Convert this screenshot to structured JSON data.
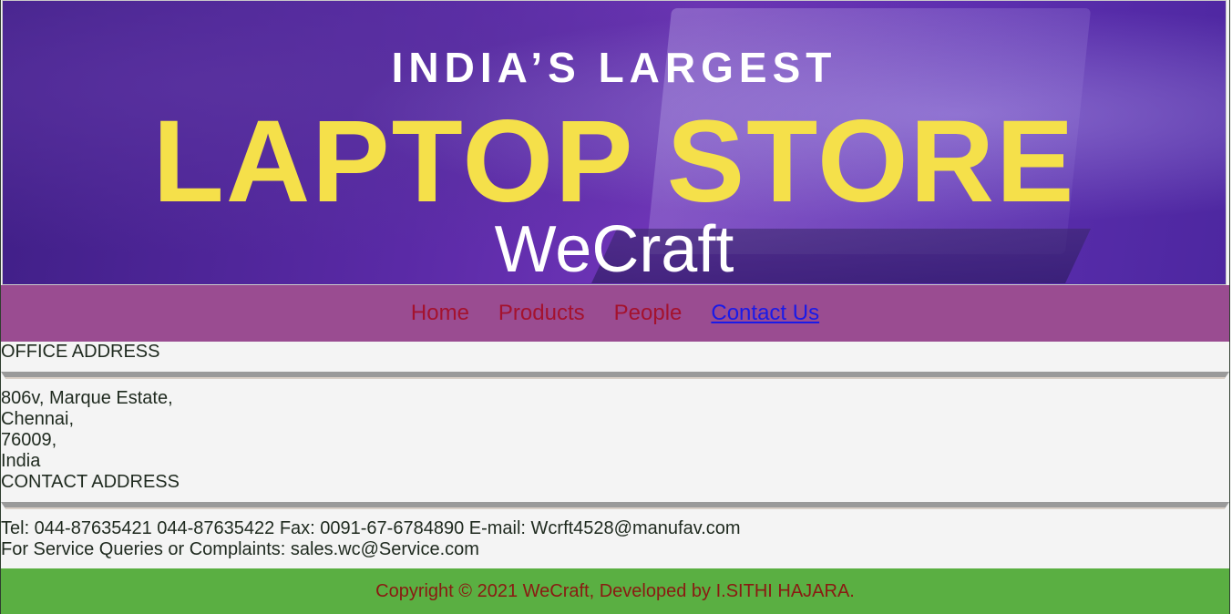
{
  "banner": {
    "top_text": "INDIA’S LARGEST",
    "main_text": "LAPTOP STORE",
    "brand": "WeCraft"
  },
  "nav": {
    "items": [
      {
        "label": "Home"
      },
      {
        "label": "Products"
      },
      {
        "label": "People"
      },
      {
        "label": "Contact Us"
      }
    ]
  },
  "office": {
    "title": "OFFICE ADDRESS",
    "lines": [
      "806v, Marque Estate,",
      "Chennai,",
      "76009,",
      "India"
    ]
  },
  "contact": {
    "title": "CONTACT ADDRESS",
    "line1": "Tel: 044-87635421 044-87635422 Fax: 0091-67-6784890 E-mail: Wcrft4528@manufav.com",
    "line2": "For Service Queries or Complaints: sales.wc@Service.com"
  },
  "footer": {
    "text": "Copyright © 2021 WeCraft, Developed by I.SITHI HAJARA."
  },
  "colors": {
    "nav_bg": "#9a4c91",
    "nav_link": "#a4122e",
    "active_link": "#1a1ae8",
    "footer_bg": "#5aaf42",
    "banner_accent": "#f5e04a"
  }
}
